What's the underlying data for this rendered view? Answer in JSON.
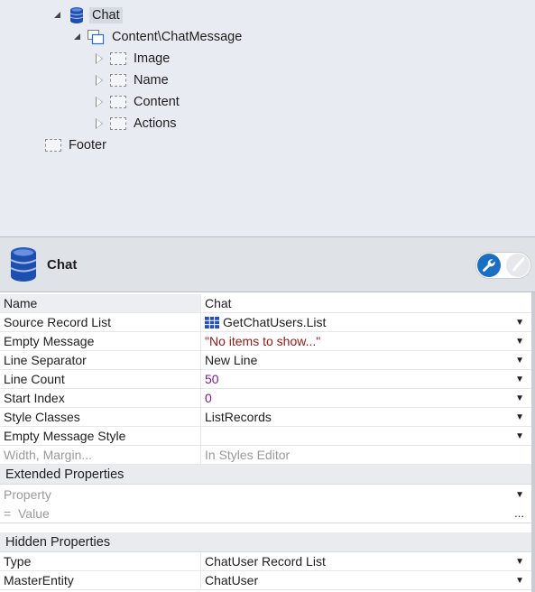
{
  "tree": {
    "nodes": [
      {
        "label": "Chat",
        "toggle": "expanded",
        "icon": "database-icon"
      },
      {
        "label": "Content\\ChatMessage",
        "toggle": "expanded",
        "icon": "list-records-icon"
      },
      {
        "label": "Image",
        "toggle": "collapsed",
        "icon": "placeholder-container-icon"
      },
      {
        "label": "Name",
        "toggle": "collapsed",
        "icon": "placeholder-container-icon"
      },
      {
        "label": "Content",
        "toggle": "collapsed",
        "icon": "placeholder-container-icon"
      },
      {
        "label": "Actions",
        "toggle": "collapsed",
        "icon": "placeholder-container-icon"
      },
      {
        "label": "Footer",
        "toggle": "none",
        "icon": "placeholder-container-icon"
      }
    ]
  },
  "header": {
    "title": "Chat",
    "icon": "database-icon",
    "toggles": [
      "wrench-icon",
      "brush-icon"
    ],
    "accent_color": "#1a6fc4"
  },
  "properties": {
    "rows": [
      {
        "name": "Name",
        "value": "Chat"
      },
      {
        "name": "Source Record List",
        "value": "GetChatUsers.List"
      },
      {
        "name": "Empty Message",
        "value": "\"No items to show...\""
      },
      {
        "name": "Line Separator",
        "value": "New Line"
      },
      {
        "name": "Line Count",
        "value": "50"
      },
      {
        "name": "Start Index",
        "value": "0"
      },
      {
        "name": "Style Classes",
        "value": "ListRecords"
      },
      {
        "name": "Empty Message Style",
        "value": ""
      },
      {
        "name": "Width, Margin...",
        "value": "In Styles Editor"
      }
    ],
    "extended": {
      "title": "Extended Properties",
      "property_placeholder": "Property",
      "value_prefix": "=",
      "value_placeholder": "Value",
      "more": "..."
    },
    "hidden": {
      "title": "Hidden Properties",
      "rows": [
        {
          "name": "Type",
          "value": "ChatUser Record List"
        },
        {
          "name": "MasterEntity",
          "value": "ChatUser"
        }
      ]
    }
  },
  "colors": {
    "string_value": "#8b1a1a",
    "number_value": "#7a1f86",
    "tree_background": "#e8ecf2"
  }
}
